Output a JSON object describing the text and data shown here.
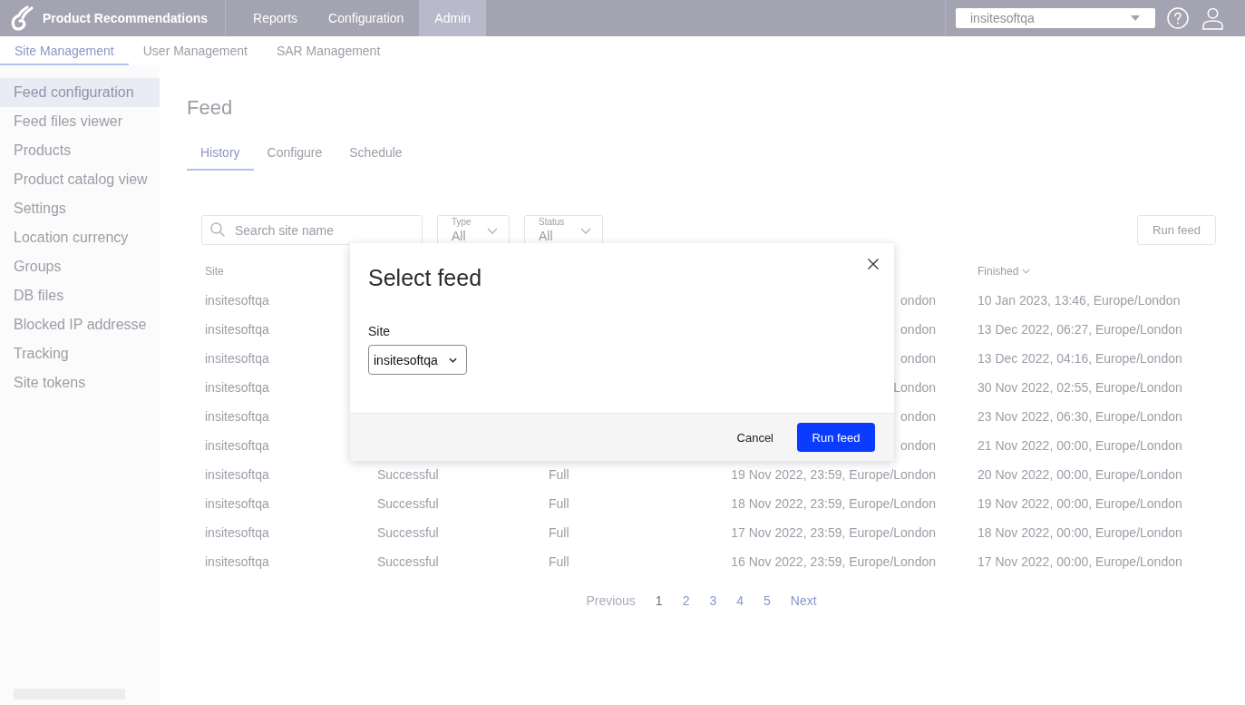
{
  "header": {
    "app_title": "Product Recommendations",
    "nav": [
      {
        "label": "Reports",
        "selected": false
      },
      {
        "label": "Configuration",
        "selected": false
      },
      {
        "label": "Admin",
        "selected": true
      }
    ],
    "site_select": {
      "value": "insitesoftqa"
    }
  },
  "subnav": [
    {
      "label": "Site Management",
      "selected": true
    },
    {
      "label": "User Management",
      "selected": false
    },
    {
      "label": "SAR Management",
      "selected": false
    }
  ],
  "sidebar": {
    "items": [
      {
        "label": "Feed configuration",
        "selected": true
      },
      {
        "label": "Feed files viewer",
        "selected": false
      },
      {
        "label": "Products",
        "selected": false
      },
      {
        "label": "Product catalog view",
        "selected": false
      },
      {
        "label": "Settings",
        "selected": false
      },
      {
        "label": "Location currency",
        "selected": false
      },
      {
        "label": "Groups",
        "selected": false
      },
      {
        "label": "DB files",
        "selected": false
      },
      {
        "label": "Blocked IP addresse",
        "selected": false
      },
      {
        "label": "Tracking",
        "selected": false
      },
      {
        "label": "Site tokens",
        "selected": false
      }
    ]
  },
  "page": {
    "title": "Feed",
    "tabs": [
      {
        "label": "History",
        "selected": true
      },
      {
        "label": "Configure",
        "selected": false
      },
      {
        "label": "Schedule",
        "selected": false
      }
    ],
    "search": {
      "placeholder": "Search site name"
    },
    "filters": [
      {
        "label": "Type",
        "value": "All"
      },
      {
        "label": "Status",
        "value": "All"
      }
    ],
    "run_button": "Run feed"
  },
  "table": {
    "headers": {
      "site": {
        "label": "Site",
        "sorted": false
      },
      "finished": {
        "label": "Finished",
        "sorted": true
      }
    },
    "rows": [
      {
        "site": "insitesoftqa",
        "column_4": "ondon",
        "finished": "10 Jan 2023, 13:46, Europe/London"
      },
      {
        "site": "insitesoftqa",
        "column_4": "ondon",
        "finished": "13 Dec 2022, 06:27, Europe/London"
      },
      {
        "site": "insitesoftqa",
        "column_4": "ondon",
        "finished": "13 Dec 2022, 04:16, Europe/London"
      },
      {
        "site": "insitesoftqa",
        "column_4": "London",
        "finished": "30 Nov 2022, 02:55, Europe/London"
      },
      {
        "site": "insitesoftqa",
        "column_4": "ondon",
        "finished": "23 Nov 2022, 06:30, Europe/London"
      },
      {
        "site": "insitesoftqa",
        "column_4": "ondon",
        "finished": "21 Nov 2022, 00:00, Europe/London"
      },
      {
        "site": "insitesoftqa",
        "column_2": "Successful",
        "column_3": "Full",
        "column_4": "19 Nov 2022, 23:59, Europe/London",
        "finished": "20 Nov 2022, 00:00, Europe/London"
      },
      {
        "site": "insitesoftqa",
        "column_2": "Successful",
        "column_3": "Full",
        "column_4": "18 Nov 2022, 23:59, Europe/London",
        "finished": "19 Nov 2022, 00:00, Europe/London"
      },
      {
        "site": "insitesoftqa",
        "column_2": "Successful",
        "column_3": "Full",
        "column_4": "17 Nov 2022, 23:59, Europe/London",
        "finished": "18 Nov 2022, 00:00, Europe/London"
      },
      {
        "site": "insitesoftqa",
        "column_2": "Successful",
        "column_3": "Full",
        "column_4": "16 Nov 2022, 23:59, Europe/London",
        "finished": "17 Nov 2022, 00:00, Europe/London"
      }
    ]
  },
  "pagination": {
    "previous": {
      "label": "Previous",
      "disabled": true
    },
    "pages": [
      {
        "label": "1",
        "selected": true
      },
      {
        "label": "2",
        "selected": false
      },
      {
        "label": "3",
        "selected": false
      },
      {
        "label": "4",
        "selected": false
      },
      {
        "label": "5",
        "selected": false
      }
    ],
    "next": {
      "label": "Next",
      "disabled": false
    }
  },
  "dialog": {
    "title": "Select feed",
    "field": {
      "label": "Site",
      "value": "insitesoftqa"
    },
    "buttons": [
      {
        "label": "Cancel",
        "kind": "secondary"
      },
      {
        "label": "Run feed",
        "kind": "primary"
      }
    ]
  }
}
